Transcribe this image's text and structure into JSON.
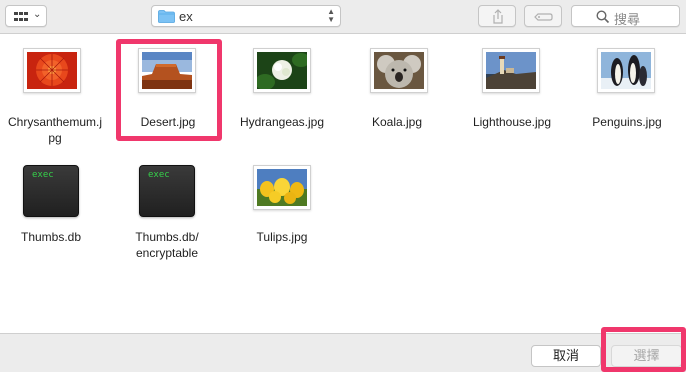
{
  "toolbar": {
    "view_icon": "icon-grid-icon",
    "path_label": "ex",
    "search_placeholder": "搜尋"
  },
  "files": [
    {
      "name": "Chrysanthemum.j",
      "name2": "pg",
      "kind": "image",
      "icon": "chrysanthemum-photo"
    },
    {
      "name": "Desert.jpg",
      "kind": "image",
      "icon": "desert-photo",
      "selected": true
    },
    {
      "name": "Hydrangeas.jpg",
      "kind": "image",
      "icon": "hydrangeas-photo"
    },
    {
      "name": "Koala.jpg",
      "kind": "image",
      "icon": "koala-photo"
    },
    {
      "name": "Lighthouse.jpg",
      "kind": "image",
      "icon": "lighthouse-photo"
    },
    {
      "name": "Penguins.jpg",
      "kind": "image",
      "icon": "penguins-photo"
    },
    {
      "name": "Thumbs.db",
      "kind": "exec",
      "icon_text": "exec"
    },
    {
      "name": "Thumbs.db/",
      "name2": "encryptable",
      "kind": "exec",
      "icon_text": "exec"
    },
    {
      "name": "Tulips.jpg",
      "kind": "image",
      "icon": "tulips-photo"
    }
  ],
  "footer": {
    "cancel_label": "取消",
    "choose_label": "選擇"
  },
  "colors": {
    "highlight": "#f0376c",
    "folder": "#7cc2f4",
    "exec_text": "#35d04a",
    "toolbar_bg": "#ececec"
  }
}
